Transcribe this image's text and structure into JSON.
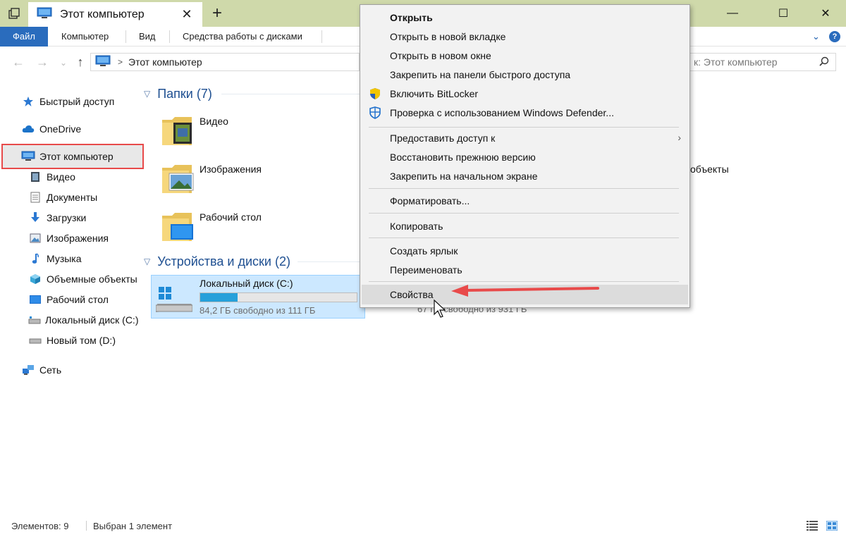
{
  "window": {
    "tab_title": "Этот компьютер",
    "close_tab_glyph": "✕",
    "new_tab_glyph": "+",
    "minimize_glyph": "—",
    "maximize_glyph": "☐",
    "close_glyph": "✕"
  },
  "ribbon": {
    "tabs": [
      "Файл",
      "Компьютер",
      "Вид",
      "Средства работы с дисками"
    ],
    "expand_glyph": "⌄",
    "help_glyph": "?"
  },
  "address": {
    "back_glyph": "←",
    "forward_glyph": "→",
    "recent_glyph": "⌄",
    "up_glyph": "↑",
    "crumb_sep": ">",
    "path": "Этот компьютер",
    "search_placeholder": "к: Этот компьютер"
  },
  "sidebar": {
    "quick_access": "Быстрый доступ",
    "onedrive": "OneDrive",
    "this_pc": "Этот компьютер",
    "items": [
      "Видео",
      "Документы",
      "Загрузки",
      "Изображения",
      "Музыка",
      "Объемные объекты",
      "Рабочий стол",
      "Локальный диск (С:)",
      "Новый том (D:)"
    ],
    "network": "Сеть"
  },
  "content": {
    "folders_header": "Папки (7)",
    "folders": [
      "Видео",
      "Изображения",
      "Рабочий стол"
    ],
    "partial_folder": "объекты",
    "devices_header": "Устройства и диски (2)",
    "drive_c": {
      "name": "Локальный диск (C:)",
      "free_text": "84,2 ГБ свободно из 111 ГБ",
      "used_fraction": 0.24
    },
    "drive_d_partial": "67 ГБ свободно из 931 ГБ"
  },
  "status": {
    "items_count": "Элементов: 9",
    "selected": "Выбран 1 элемент"
  },
  "context_menu": {
    "open": "Открыть",
    "open_new_tab": "Открыть в новой вкладке",
    "open_new_window": "Открыть в новом окне",
    "pin_quick_access": "Закрепить на панели быстрого доступа",
    "bitlocker": "Включить BitLocker",
    "defender": "Проверка с использованием Windows Defender...",
    "give_access": "Предоставить доступ к",
    "restore_previous": "Восстановить прежнюю версию",
    "pin_start": "Закрепить на начальном экране",
    "format": "Форматировать...",
    "copy": "Копировать",
    "create_shortcut": "Создать ярлык",
    "rename": "Переименовать",
    "properties": "Свойства",
    "submenu_glyph": "›"
  },
  "colors": {
    "titlebar": "#cfd9aa",
    "file_tab": "#2a6cbd",
    "header_blue": "#1e4f91",
    "selection": "#cce8ff",
    "highlight_red": "#e84a4a",
    "drive_fill": "#26a0da"
  }
}
